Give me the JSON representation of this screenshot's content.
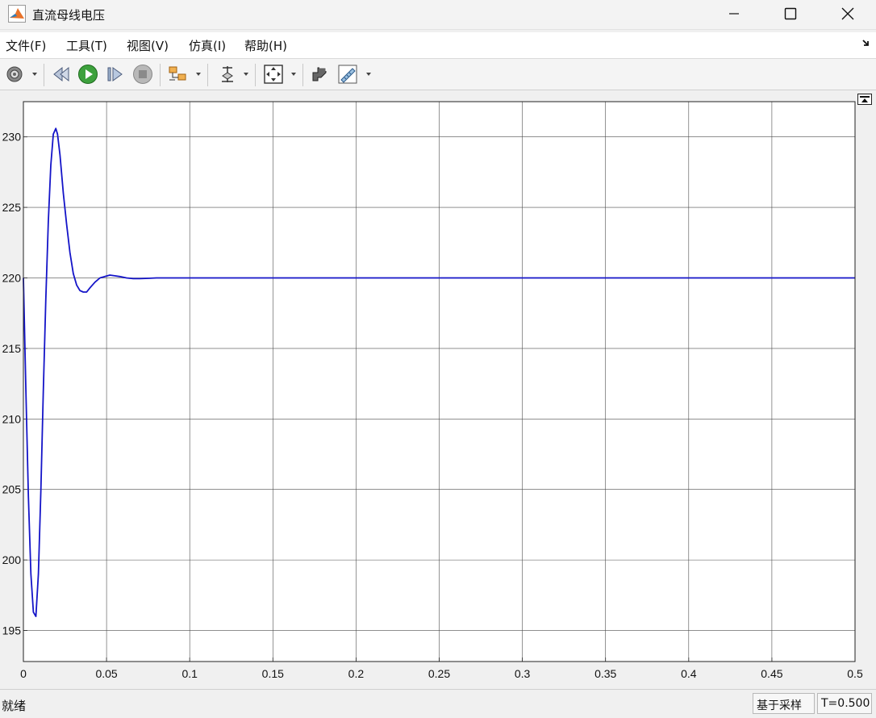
{
  "window": {
    "title": "直流母线电压",
    "app_icon": "matlab-icon",
    "controls": [
      "minimize-icon",
      "maximize-icon",
      "close-icon"
    ]
  },
  "menu": {
    "items": [
      {
        "label": "文件(F)"
      },
      {
        "label": "工具(T)"
      },
      {
        "label": "视图(V)"
      },
      {
        "label": "仿真(I)"
      },
      {
        "label": "帮助(H)"
      }
    ],
    "collapse_icon": "dock-arrow-icon"
  },
  "toolbar": {
    "buttons": [
      "settings-icon",
      "step-back-icon",
      "run-icon",
      "step-forward-icon",
      "stop-icon",
      "signal-select-icon",
      "cursor-probe-icon",
      "zoom-fit-icon",
      "highlight-block-icon",
      "measure-icon"
    ]
  },
  "plot": {
    "undock_icon": "undock-icon",
    "line_color": "#1414c8",
    "grid": true
  },
  "chart_data": {
    "type": "line",
    "title": "",
    "xlabel": "",
    "ylabel": "",
    "xlim": [
      0,
      0.5
    ],
    "ylim": [
      192.8,
      232.5
    ],
    "xticks": [
      "0",
      "0.05",
      "0.1",
      "0.15",
      "0.2",
      "0.25",
      "0.3",
      "0.35",
      "0.4",
      "0.45",
      "0.5"
    ],
    "yticks": [
      "195",
      "200",
      "205",
      "210",
      "215",
      "220",
      "225",
      "230"
    ],
    "series": [
      {
        "color": "#1414c8",
        "x": [
          0,
          0.0015,
          0.003,
          0.0045,
          0.006,
          0.0075,
          0.009,
          0.0105,
          0.012,
          0.0135,
          0.015,
          0.0165,
          0.018,
          0.0195,
          0.0205,
          0.022,
          0.024,
          0.026,
          0.028,
          0.03,
          0.032,
          0.034,
          0.036,
          0.038,
          0.04,
          0.043,
          0.046,
          0.049,
          0.052,
          0.055,
          0.058,
          0.062,
          0.066,
          0.07,
          0.075,
          0.08,
          0.09,
          0.1,
          0.15,
          0.2,
          0.25,
          0.3,
          0.35,
          0.4,
          0.45,
          0.5
        ],
        "y": [
          220,
          212,
          204.5,
          199,
          196.3,
          196,
          199,
          205,
          212,
          218.5,
          224,
          228,
          230.2,
          230.6,
          230.2,
          228.7,
          226,
          223.8,
          221.8,
          220.3,
          219.5,
          219.1,
          219.0,
          219.0,
          219.3,
          219.7,
          220.0,
          220.1,
          220.2,
          220.15,
          220.1,
          220.0,
          219.95,
          219.95,
          219.97,
          220.0,
          220.0,
          220.0,
          220.0,
          220.0,
          220.0,
          220.0,
          220.0,
          220.0,
          220.0,
          220.0
        ]
      }
    ]
  },
  "status": {
    "text": "就绪",
    "mode": "基于采样",
    "time": "T=0.500"
  }
}
